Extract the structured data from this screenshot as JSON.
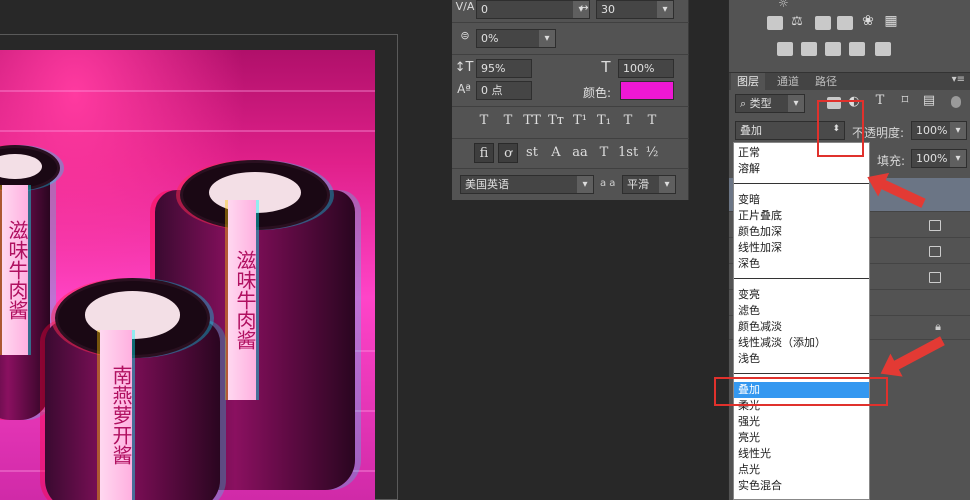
{
  "character_panel": {
    "tracking_value": "0",
    "kerning_value": "30",
    "baseline_shift_pct": "0%",
    "vertical_scale": "95%",
    "horizontal_scale": "100%",
    "baseline_shift": "0 点",
    "color_label": "颜色:",
    "color_value": "#ee18d4",
    "type_buttons": [
      "T",
      "T",
      "TT",
      "Tт",
      "T¹",
      "T₁",
      "T",
      "T"
    ],
    "opentype_buttons": [
      "fi",
      "ơ",
      "st",
      "A",
      "aa",
      "T",
      "1st",
      "½"
    ],
    "language": "美国英语",
    "aa_label": "a a",
    "antialias": "平滑"
  },
  "layers_panel": {
    "tabs": [
      "图层",
      "通道",
      "路径"
    ],
    "filter_kind": "类型",
    "filter_icons": [
      "image-filter-icon",
      "adjustment-filter-icon",
      "type-filter-icon",
      "shape-filter-icon",
      "smart-filter-icon"
    ],
    "blend_mode": "叠加",
    "opacity_label": "不透明度:",
    "opacity_value": "100%",
    "fill_label": "填充:",
    "fill_value": "100%"
  },
  "blend_menu": {
    "group1": [
      "正常",
      "溶解"
    ],
    "group2": [
      "变暗",
      "正片叠底",
      "颜色加深",
      "线性加深",
      "深色"
    ],
    "group3": [
      "变亮",
      "滤色",
      "颜色减淡",
      "线性减淡（添加）",
      "浅色"
    ],
    "group4": [
      "叠加",
      "柔光",
      "强光",
      "亮光",
      "线性光",
      "点光",
      "实色混合"
    ],
    "selected": "叠加"
  },
  "photo": {
    "band1": "滋味牛肉酱",
    "band2": "滋味牛肉酱",
    "band3": "南燕萝开酱"
  },
  "colors": {
    "panel_bg": "#535353",
    "app_bg": "#282828",
    "highlight": "#e0312c",
    "selection": "#3498f0",
    "swatch": "#ee18d4"
  }
}
